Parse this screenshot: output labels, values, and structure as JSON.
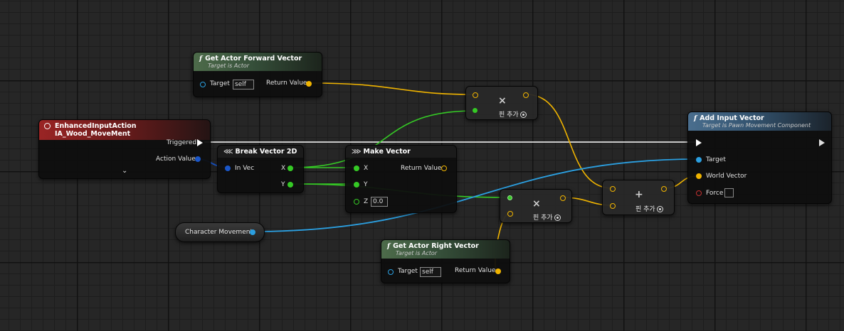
{
  "colors": {
    "float_pin": "#f0b400",
    "vector_pin": "#f0b400",
    "green_pin": "#35c925",
    "object_pin": "#2b9fe0",
    "exec": "#ffffff",
    "red_pin": "#c43030"
  },
  "nodes": {
    "forward": {
      "title": "Get Actor Forward Vector",
      "subtitle": "Target is Actor",
      "target_label": "Target",
      "target_value": "self",
      "return_label": "Return Value"
    },
    "right": {
      "title": "Get Actor Right Vector",
      "subtitle": "Target is Actor",
      "target_label": "Target",
      "target_value": "self",
      "return_label": "Return Value"
    },
    "input": {
      "title": "EnhancedInputAction IA_Wood_MoveMent",
      "triggered_label": "Triggered",
      "action_value_label": "Action Value"
    },
    "break": {
      "title": "Break Vector 2D",
      "in_label": "In Vec",
      "x_label": "X",
      "y_label": "Y"
    },
    "make": {
      "title": "Make Vector",
      "x_label": "X",
      "y_label": "Y",
      "z_label": "Z",
      "z_value": "0.0",
      "return_label": "Return Value"
    },
    "mult1": {
      "symbol": "×",
      "add_pin": "핀 추가"
    },
    "mult2": {
      "symbol": "×",
      "add_pin": "핀 추가"
    },
    "add": {
      "symbol": "+",
      "add_pin": "핀 추가"
    },
    "addinput": {
      "title": "Add Input Vector",
      "subtitle": "Target is Pawn Movement Component",
      "target_label": "Target",
      "world_label": "World Vector",
      "force_label": "Force"
    },
    "charmove": {
      "label": "Character Movement"
    }
  }
}
